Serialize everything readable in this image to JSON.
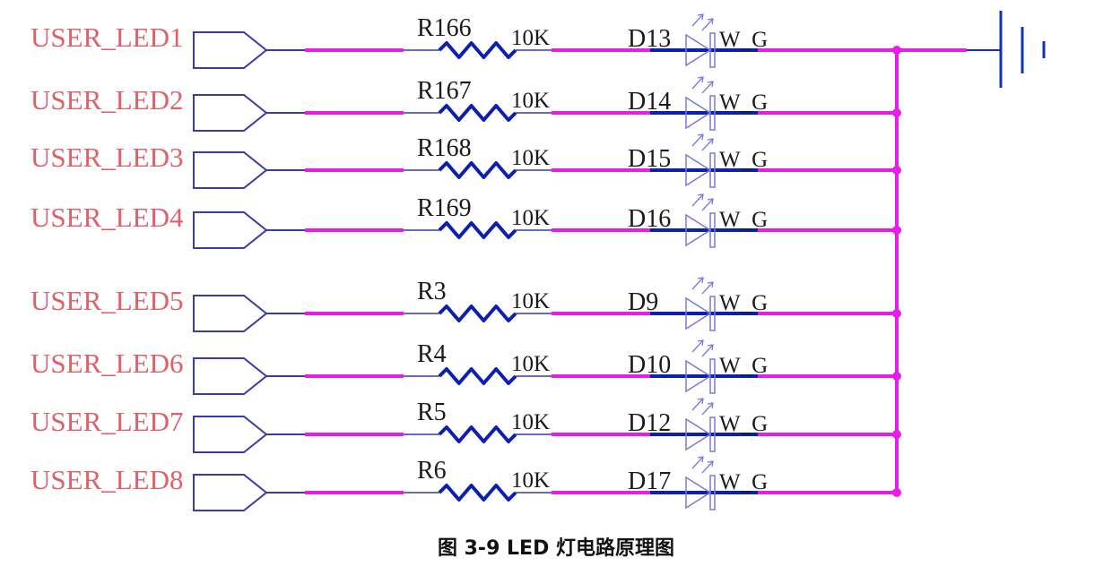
{
  "colors": {
    "label": "#e0606a",
    "port": "#3a3aa8",
    "wire_blue": "#0b1fb0",
    "wire_magenta": "#e61ee6",
    "symbol": "#3a3aa8",
    "led": "#7a7ad6",
    "ground": "#1030c0"
  },
  "channels": [
    {
      "net": "USER_LED1",
      "resistor": "R166",
      "resistor_value": "10K",
      "diode": "D13",
      "diode_part": "W_G"
    },
    {
      "net": "USER_LED2",
      "resistor": "R167",
      "resistor_value": "10K",
      "diode": "D14",
      "diode_part": "W_G"
    },
    {
      "net": "USER_LED3",
      "resistor": "R168",
      "resistor_value": "10K",
      "diode": "D15",
      "diode_part": "W_G"
    },
    {
      "net": "USER_LED4",
      "resistor": "R169",
      "resistor_value": "10K",
      "diode": "D16",
      "diode_part": "W_G"
    },
    {
      "net": "USER_LED5",
      "resistor": "R3",
      "resistor_value": "10K",
      "diode": "D9",
      "diode_part": "W_G"
    },
    {
      "net": "USER_LED6",
      "resistor": "R4",
      "resistor_value": "10K",
      "diode": "D10",
      "diode_part": "W_G"
    },
    {
      "net": "USER_LED7",
      "resistor": "R5",
      "resistor_value": "10K",
      "diode": "D12",
      "diode_part": "W_G"
    },
    {
      "net": "USER_LED8",
      "resistor": "R6",
      "resistor_value": "10K",
      "diode": "D17",
      "diode_part": "W_G"
    }
  ],
  "caption": "图 3-9 LED 灯电路原理图"
}
